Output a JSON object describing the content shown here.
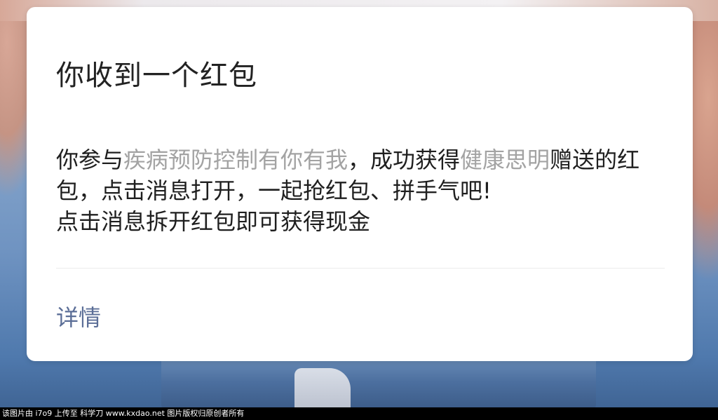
{
  "dialog": {
    "title": "你收到一个红包",
    "message": {
      "prefix": "你参与",
      "activity": "疾病预防控制有你有我",
      "middle": "，成功获得",
      "sponsor": "健康思明",
      "suffix": "赠送的红包，点击消息打开，一起抢红包、拼手气吧!",
      "line3": "点击消息拆开红包即可获得现金"
    },
    "detail_button": "详情"
  },
  "footer": {
    "credit": "该图片由 i7o9 上传至 科学刀 www.kxdao.net 图片版权归原创者所有"
  },
  "colors": {
    "highlight_text": "#a3a3a3",
    "link": "#5b6e97",
    "dialog_bg": "#ffffff"
  }
}
